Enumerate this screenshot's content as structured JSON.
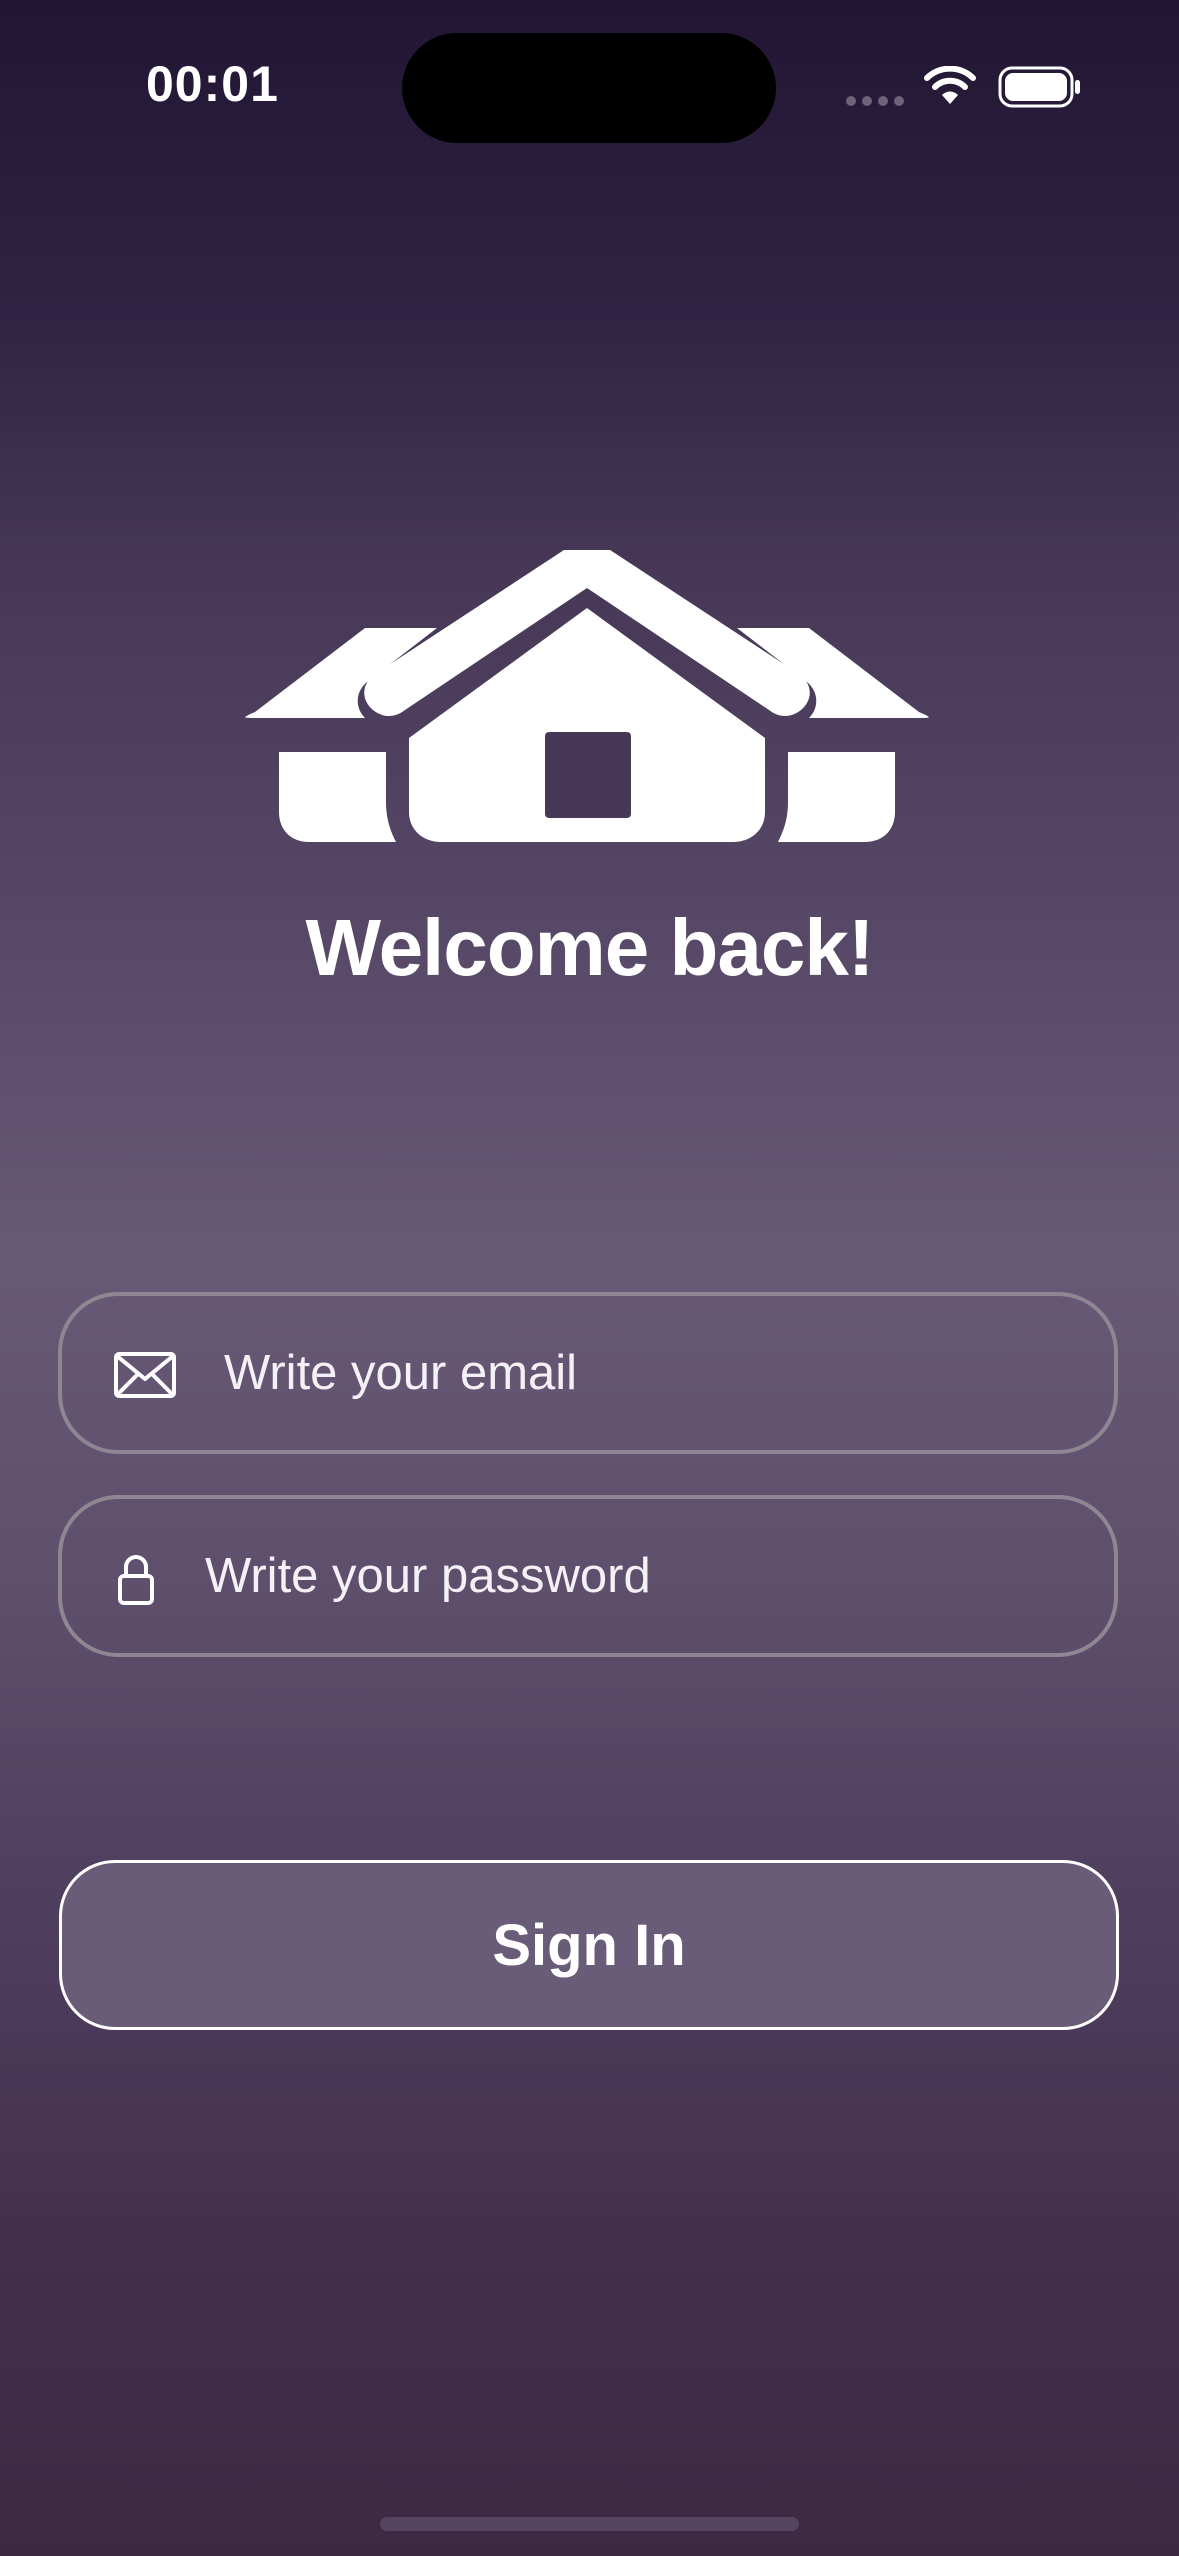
{
  "status_bar": {
    "time": "00:01",
    "icons": [
      "signal-dots-icon",
      "wifi-icon",
      "battery-icon"
    ]
  },
  "logo": {
    "icon": "house-icon"
  },
  "heading": {
    "title": "Welcome back!"
  },
  "form": {
    "email": {
      "icon": "envelope-icon",
      "placeholder": "Write your email",
      "value": ""
    },
    "password": {
      "icon": "lock-icon",
      "placeholder": "Write your password",
      "value": ""
    }
  },
  "actions": {
    "sign_in_label": "Sign In"
  },
  "colors": {
    "background_top": "#221634",
    "background_mid": "#675a76",
    "background_bottom": "#3d2943",
    "field_border": "#8e8793",
    "button_fill": "#695c78",
    "text": "#ffffff"
  }
}
